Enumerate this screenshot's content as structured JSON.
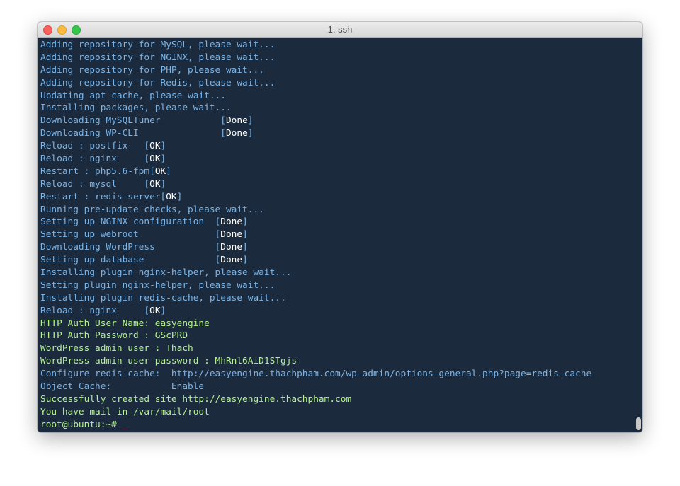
{
  "window": {
    "title": "1. ssh"
  },
  "terminal": {
    "lines": [
      {
        "text": "Adding repository for MySQL, please wait...",
        "color": "blue"
      },
      {
        "text": "Adding repository for NGINX, please wait...",
        "color": "blue"
      },
      {
        "text": "Adding repository for PHP, please wait...",
        "color": "blue"
      },
      {
        "text": "Adding repository for Redis, please wait...",
        "color": "blue"
      },
      {
        "text": "Updating apt-cache, please wait...",
        "color": "blue"
      },
      {
        "text": "Installing packages, please wait...",
        "color": "blue"
      },
      {
        "label": "Downloading MySQLTuner           ",
        "status": "Done"
      },
      {
        "label": "Downloading WP-CLI               ",
        "status": "Done"
      },
      {
        "label": "Reload : postfix   ",
        "status": "OK"
      },
      {
        "label": "Reload : nginx     ",
        "status": "OK"
      },
      {
        "label": "Restart : php5.6-fpm",
        "status": "OK"
      },
      {
        "label": "Reload : mysql     ",
        "status": "OK"
      },
      {
        "label": "Restart : redis-server",
        "status": "OK"
      },
      {
        "text": "Running pre-update checks, please wait...",
        "color": "blue"
      },
      {
        "label": "Setting up NGINX configuration  ",
        "status": "Done"
      },
      {
        "label": "Setting up webroot              ",
        "status": "Done"
      },
      {
        "label": "Downloading WordPress           ",
        "status": "Done"
      },
      {
        "label": "Setting up database             ",
        "status": "Done"
      },
      {
        "text": "Installing plugin nginx-helper, please wait...",
        "color": "blue"
      },
      {
        "text": "Setting plugin nginx-helper, please wait...",
        "color": "blue"
      },
      {
        "text": "Installing plugin redis-cache, please wait...",
        "color": "blue"
      },
      {
        "label": "Reload : nginx     ",
        "status": "OK"
      },
      {
        "text": "HTTP Auth User Name: easyengine",
        "color": "green"
      },
      {
        "text": "HTTP Auth Password : GScPRD",
        "color": "green"
      },
      {
        "text": "WordPress admin user : Thach",
        "color": "green"
      },
      {
        "text": "WordPress admin user password : MhRnl6AiD1STgjs",
        "color": "green"
      },
      {
        "text": "Configure redis-cache:  http://easyengine.thachpham.com/wp-admin/options-general.php?page=redis-cache",
        "color": "blue"
      },
      {
        "text": "Object Cache:           Enable",
        "color": "blue"
      },
      {
        "text": "Successfully created site http://easyengine.thachpham.com",
        "color": "green"
      },
      {
        "text": "You have mail in /var/mail/root",
        "color": "green"
      }
    ],
    "prompt": "root@ubuntu:~# ",
    "cursor": "_"
  },
  "colors": {
    "background": "#1b2b3d",
    "info_text": "#7ab4e8",
    "success_text": "#b6f28f",
    "status_text": "#ffffff",
    "cursor": "#e0467c"
  }
}
